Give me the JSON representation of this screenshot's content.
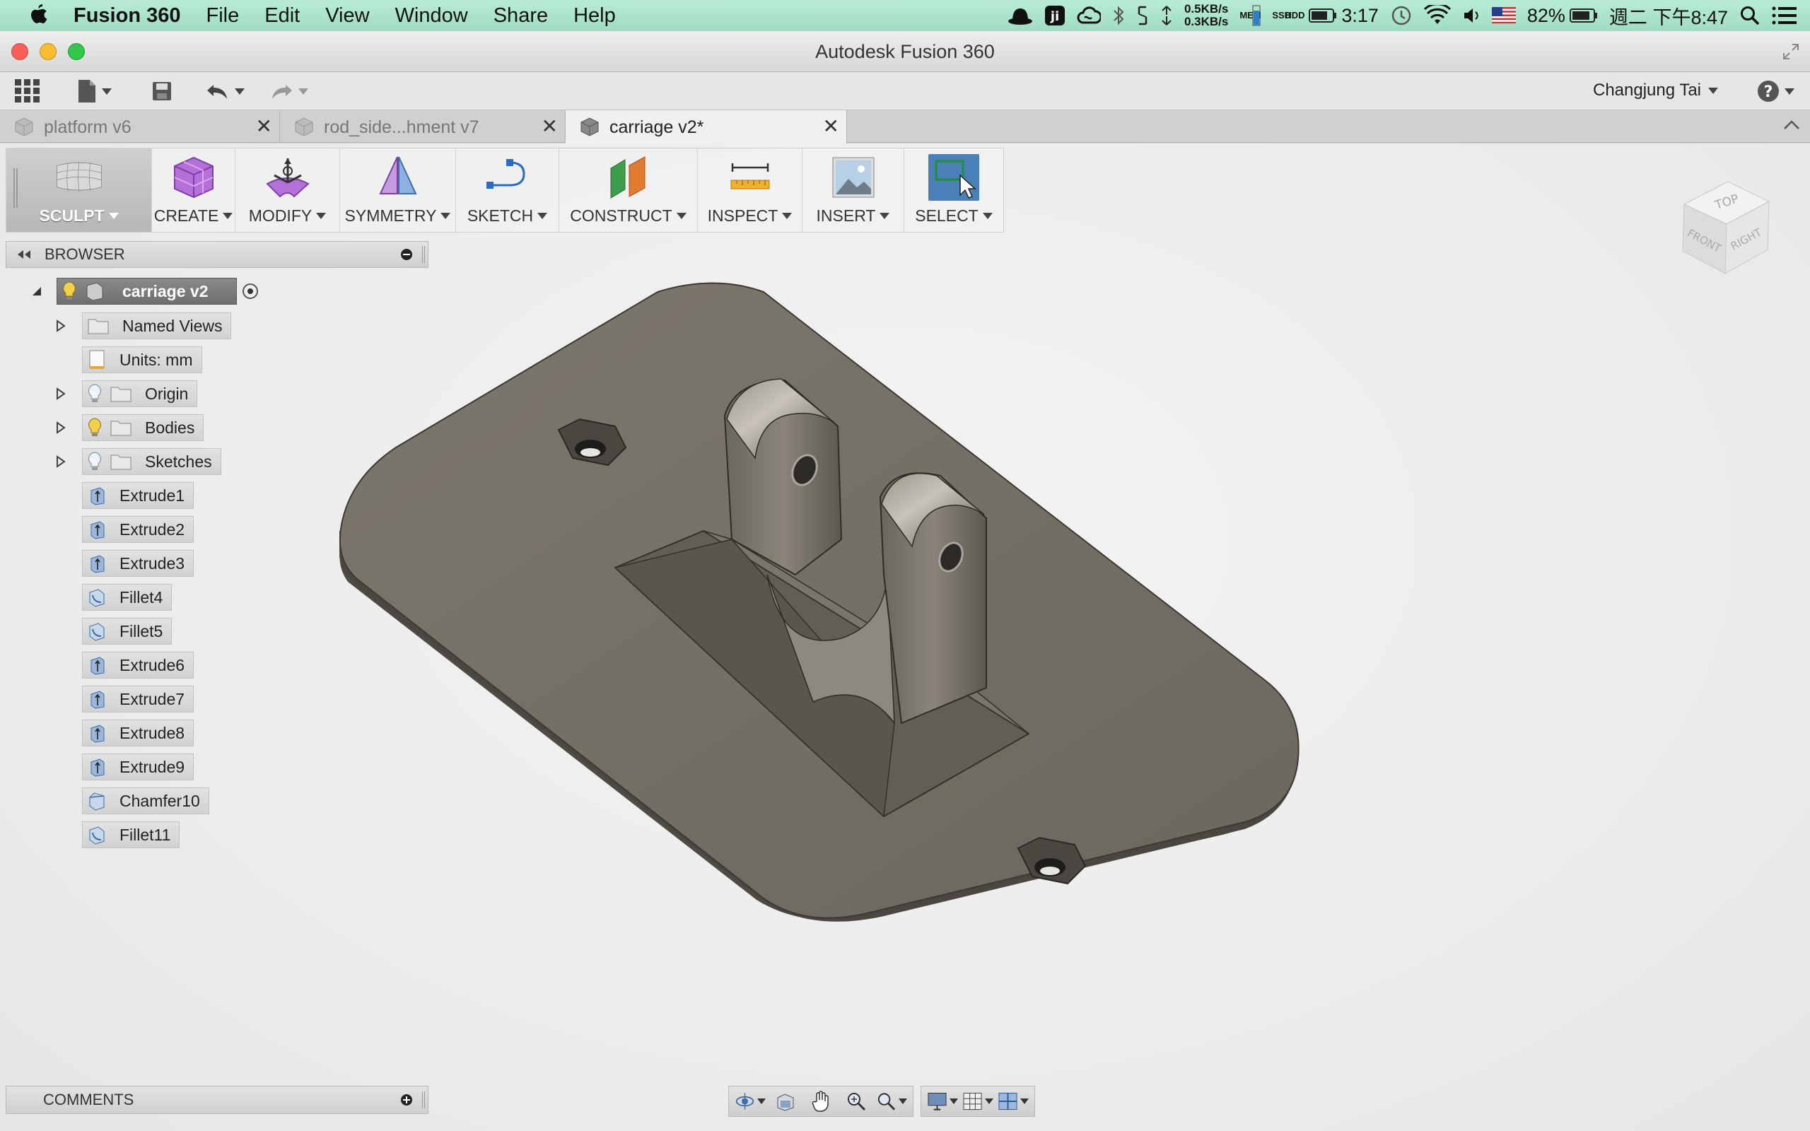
{
  "menubar": {
    "app_name": "Fusion 360",
    "items": [
      "File",
      "Edit",
      "View",
      "Window",
      "Share",
      "Help"
    ],
    "net_up": "0.5KB/s",
    "net_down": "0.3KB/s",
    "mem_label": "MEM",
    "ssd_label": "SSD",
    "hdd_label": "HDD",
    "battery_time": "3:17",
    "battery_percent": "82%",
    "datetime": "週二 下午8:47"
  },
  "window": {
    "title": "Autodesk Fusion 360"
  },
  "toolbar": {
    "user_name": "Changjung Tai"
  },
  "tabs": [
    {
      "label": "platform v6",
      "active": false
    },
    {
      "label": "rod_side...hment v7",
      "active": false
    },
    {
      "label": "carriage v2*",
      "active": true
    }
  ],
  "ribbon": {
    "workspace": "SCULPT",
    "groups": [
      "CREATE",
      "MODIFY",
      "SYMMETRY",
      "SKETCH",
      "CONSTRUCT",
      "INSPECT",
      "INSERT",
      "SELECT"
    ]
  },
  "browser": {
    "header": "BROWSER",
    "root": "carriage v2",
    "folders": [
      "Named Views",
      "Units: mm",
      "Origin",
      "Bodies",
      "Sketches"
    ],
    "features": [
      "Extrude1",
      "Extrude2",
      "Extrude3",
      "Fillet4",
      "Fillet5",
      "Extrude6",
      "Extrude7",
      "Extrude8",
      "Extrude9",
      "Chamfer10",
      "Fillet11"
    ]
  },
  "comments": {
    "header": "COMMENTS"
  },
  "viewcube": {
    "top": "TOP",
    "front": "FRONT",
    "right": "RIGHT"
  },
  "colors": {
    "menubar": "#a8e2c9",
    "model_top": "#787368",
    "model_side": "#4d4a44",
    "select_highlight": "#4a7fb8"
  }
}
